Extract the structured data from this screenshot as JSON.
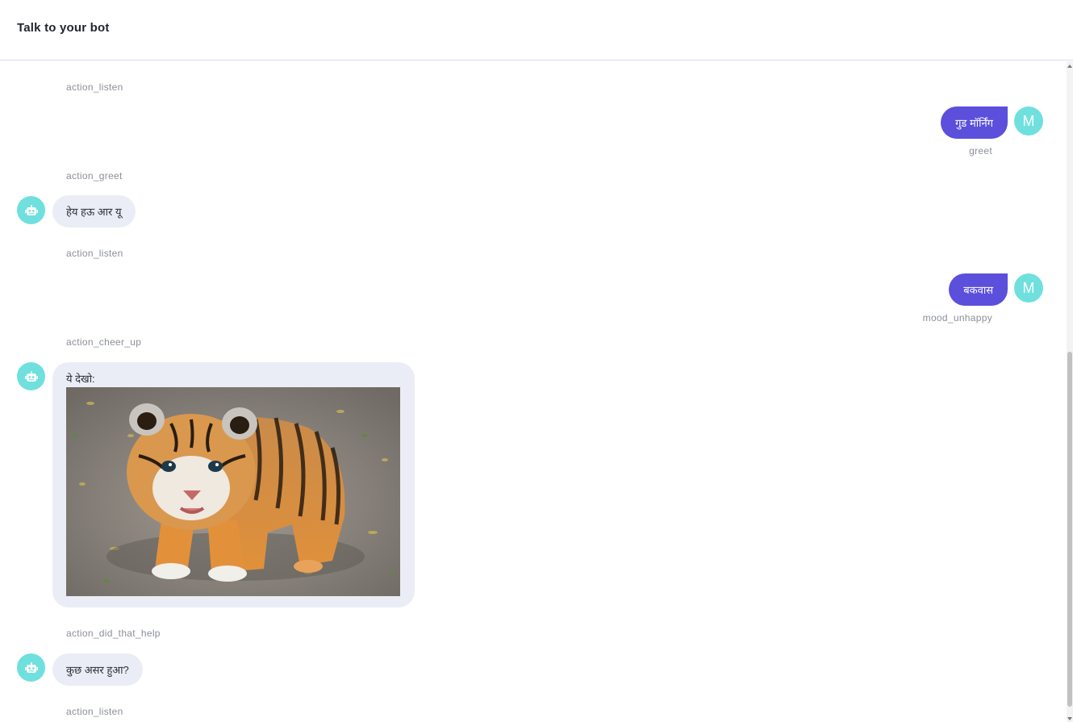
{
  "header": {
    "title": "Talk to your bot"
  },
  "conversation": {
    "action_1": "action_listen",
    "user_msg_1": {
      "text": "गुड मॉर्निंग",
      "intent": "greet",
      "avatar": "M"
    },
    "action_2": "action_greet",
    "bot_msg_1": {
      "text": "हेय हऊ आर यू"
    },
    "action_3": "action_listen",
    "user_msg_2": {
      "text": "बकवास",
      "intent": "mood_unhappy",
      "avatar": "M"
    },
    "action_4": "action_cheer_up",
    "bot_msg_2": {
      "text": "ये देखो:",
      "image": "tiger-cub-photo"
    },
    "action_5": "action_did_that_help",
    "bot_msg_3": {
      "text": "कुछ असर हुआ?"
    },
    "action_6": "action_listen"
  },
  "colors": {
    "accent": "#5b4fdc",
    "avatar": "#6fe0dd",
    "bot_bubble": "#ebedf6",
    "label": "#8a8f99"
  },
  "icons": {
    "bot_avatar": "robot-icon"
  }
}
